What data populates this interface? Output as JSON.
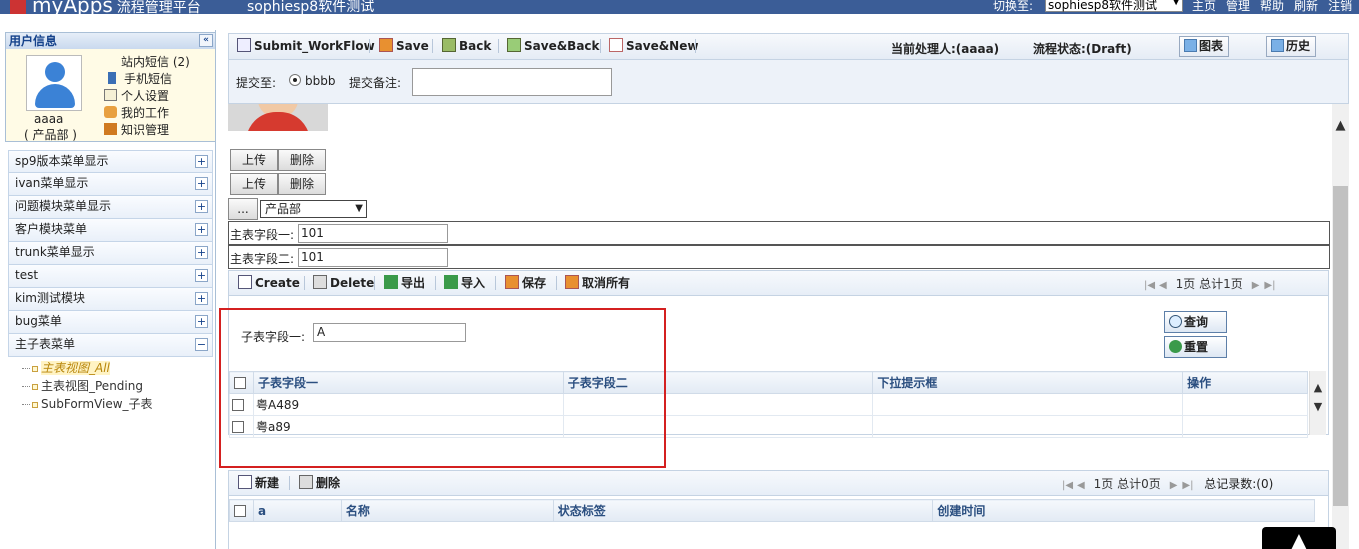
{
  "topbar": {
    "logo_text": "myApps",
    "platform": "流程管理平台",
    "system": "sophiesp8软件测试",
    "switch_label": "切换至:",
    "switch_value": "sophiesp8软件测试",
    "links": [
      "主页",
      "管理",
      "帮助",
      "刷新",
      "注销"
    ]
  },
  "sidebar": {
    "user_header": "用户信息",
    "collapse_icon": "double-chevron-left-icon",
    "user_name": "aaaa",
    "user_dept": "( 产品部 )",
    "user_menu": [
      {
        "label": "站内短信 (2)",
        "icon": "mail-icon"
      },
      {
        "label": "手机短信",
        "icon": "mobile-icon"
      },
      {
        "label": "个人设置",
        "icon": "edit-icon"
      },
      {
        "label": "我的工作",
        "icon": "user-work-icon"
      },
      {
        "label": "知识管理",
        "icon": "knowledge-icon"
      }
    ],
    "menus": [
      {
        "label": "sp9版本菜单显示",
        "toggle": "+"
      },
      {
        "label": "ivan菜单显示",
        "toggle": "+"
      },
      {
        "label": "问题模块菜单显示",
        "toggle": "+"
      },
      {
        "label": "客户模块菜单",
        "toggle": "+"
      },
      {
        "label": "trunk菜单显示",
        "toggle": "+"
      },
      {
        "label": "test",
        "toggle": "+"
      },
      {
        "label": "kim测试模块",
        "toggle": "+"
      },
      {
        "label": "bug菜单",
        "toggle": "+"
      },
      {
        "label": "主子表菜单",
        "toggle": "−"
      }
    ],
    "submenu": [
      {
        "label": "主表视图_All",
        "selected": true
      },
      {
        "label": "主表视图_Pending",
        "selected": false
      },
      {
        "label": "SubFormView_子表",
        "selected": false
      }
    ]
  },
  "toolbar": {
    "submit_workflow": "Submit_WorkFlow",
    "save": "Save",
    "back": "Back",
    "save_back": "Save&Back",
    "save_new": "Save&New",
    "handler": "当前处理人:(aaaa)",
    "flow_state": "流程状态:(Draft)",
    "chart_btn": "图表",
    "history_btn": "历史"
  },
  "submit_row": {
    "submit_to_label": "提交至:",
    "option": "bbbb",
    "remark_label": "提交备注:",
    "remark_value": ""
  },
  "form": {
    "upload1": "上传",
    "delete1": "删除",
    "upload2": "上传",
    "delete2": "删除",
    "dots_btn": "...",
    "dept_select": "产品部",
    "field1_label": "主表字段一:",
    "field1_value": "101",
    "field2_label": "主表字段二:",
    "field2_value": "101"
  },
  "subform": {
    "create": "Create",
    "delete": "Delete",
    "export": "导出",
    "import": "导入",
    "save": "保存",
    "cancel_all": "取消所有",
    "pager": "1页 总计1页",
    "search_label": "子表字段一:",
    "search_value": "A",
    "query_btn": "查询",
    "reset_btn": "重置",
    "columns": [
      "子表字段一",
      "子表字段二",
      "下拉提示框",
      "操作"
    ],
    "rows": [
      {
        "c1": "粤A489",
        "c2": "",
        "c3": "",
        "c4": ""
      },
      {
        "c1": "粤a89",
        "c2": "",
        "c3": "",
        "c4": ""
      }
    ]
  },
  "subform2": {
    "new": "新建",
    "delete": "删除",
    "pager": "1页 总计0页",
    "total": "总记录数:(0)",
    "columns": [
      "a",
      "名称",
      "状态标签",
      "创建时间"
    ]
  },
  "colors": {
    "topbar_bg": "#3b5d97",
    "highlight_border": "#d42020",
    "header_text": "#2b4f80"
  }
}
